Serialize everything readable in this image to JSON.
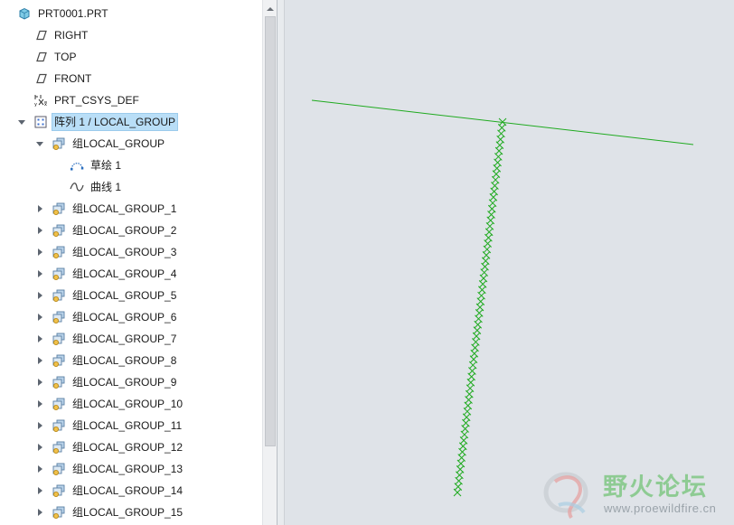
{
  "model_tree": {
    "root": {
      "label": "PRT0001.PRT",
      "icon": "part-icon"
    },
    "datums": [
      {
        "label": "RIGHT",
        "icon": "datum-plane-icon"
      },
      {
        "label": "TOP",
        "icon": "datum-plane-icon"
      },
      {
        "label": "FRONT",
        "icon": "datum-plane-icon"
      },
      {
        "label": "PRT_CSYS_DEF",
        "icon": "csys-icon"
      }
    ],
    "pattern": {
      "label": "阵列 1 / LOCAL_GROUP",
      "icon": "pattern-icon",
      "expanded": true,
      "selected": true
    },
    "first_group": {
      "label": "组LOCAL_GROUP",
      "icon": "group-icon",
      "expanded": true,
      "children": [
        {
          "label": "草绘 1",
          "icon": "sketch-icon"
        },
        {
          "label": "曲线 1",
          "icon": "curve-icon"
        }
      ]
    },
    "groups": [
      "组LOCAL_GROUP_1",
      "组LOCAL_GROUP_2",
      "组LOCAL_GROUP_3",
      "组LOCAL_GROUP_4",
      "组LOCAL_GROUP_5",
      "组LOCAL_GROUP_6",
      "组LOCAL_GROUP_7",
      "组LOCAL_GROUP_8",
      "组LOCAL_GROUP_9",
      "组LOCAL_GROUP_10",
      "组LOCAL_GROUP_11",
      "组LOCAL_GROUP_12",
      "组LOCAL_GROUP_13",
      "组LOCAL_GROUP_14",
      "组LOCAL_GROUP_15"
    ]
  },
  "viewport": {
    "background": "#dfe3e8",
    "curve_color": "#1faa1f"
  },
  "watermark": {
    "title": "野火论坛",
    "url": "www.proewildfire.cn"
  }
}
